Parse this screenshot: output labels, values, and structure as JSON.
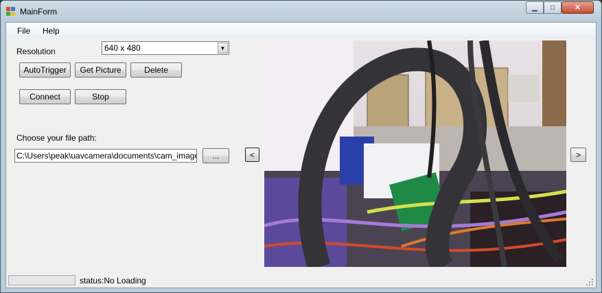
{
  "window": {
    "title": "MainForm",
    "controls": {
      "minimize": "▁",
      "maximize": "□",
      "close": "✕"
    }
  },
  "menu": {
    "items": [
      "File",
      "Help"
    ]
  },
  "resolution": {
    "label": "Resolution",
    "selected": "640 x 480"
  },
  "buttons": {
    "auto_trigger": "AutoTrigger",
    "get_picture": "Get Picture",
    "delete": "Delete",
    "connect": "Connect",
    "stop": "Stop",
    "browse": "...",
    "prev": "<",
    "next": ">"
  },
  "file_path": {
    "label": "Choose your file path:",
    "value": "C:\\Users\\peak\\uavcamera\\documents\\cam_images"
  },
  "status": {
    "text": "status:No Loading",
    "progress": 0
  },
  "icons": {
    "app": "app-icon",
    "combo": "chevron-down-icon",
    "grip": "resize-grip-icon"
  }
}
